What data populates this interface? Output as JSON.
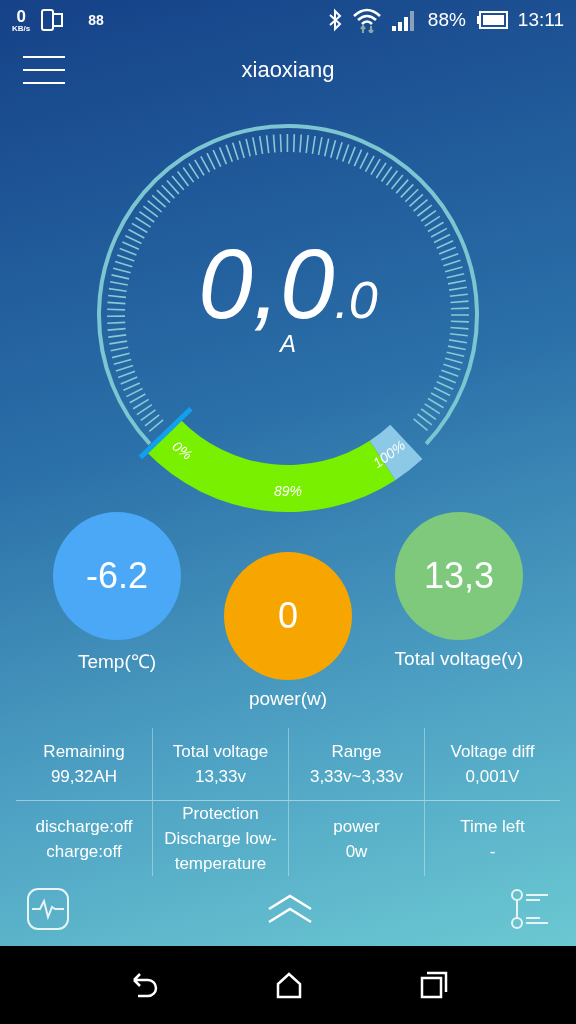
{
  "status_bar": {
    "net_speed": "0",
    "net_unit": "KB/s",
    "notification_count": "88",
    "battery_percent": "88%",
    "time": "13:11"
  },
  "header": {
    "title": "xiaoxiang"
  },
  "gauge": {
    "value_main": "0,0",
    "value_decimal": ".0",
    "unit": "A",
    "battery": {
      "start_label": "0%",
      "value_label": "89%",
      "end_label": "100%"
    }
  },
  "readings": [
    {
      "value": "-6.2",
      "caption": "Temp(℃)",
      "color": "#4aa8f6"
    },
    {
      "value": "0",
      "caption": "power(w)",
      "color": "#f7a500"
    },
    {
      "value": "13,3",
      "caption": "Total voltage(v)",
      "color": "#7ec97b"
    }
  ],
  "stats": [
    [
      {
        "label": "Remaining",
        "value": "99,32AH"
      },
      {
        "label": "Total voltage",
        "value": "13,33v"
      },
      {
        "label": "Range",
        "value": "3,33v~3,33v"
      },
      {
        "label": "Voltage diff",
        "value": "0,001V"
      }
    ],
    [
      {
        "label": "discharge:off",
        "value": "charge:off"
      },
      {
        "label": "Protection",
        "value": "Discharge low-temperature"
      },
      {
        "label": "power",
        "value": "0w"
      },
      {
        "label": "Time left",
        "value": "-"
      }
    ]
  ]
}
